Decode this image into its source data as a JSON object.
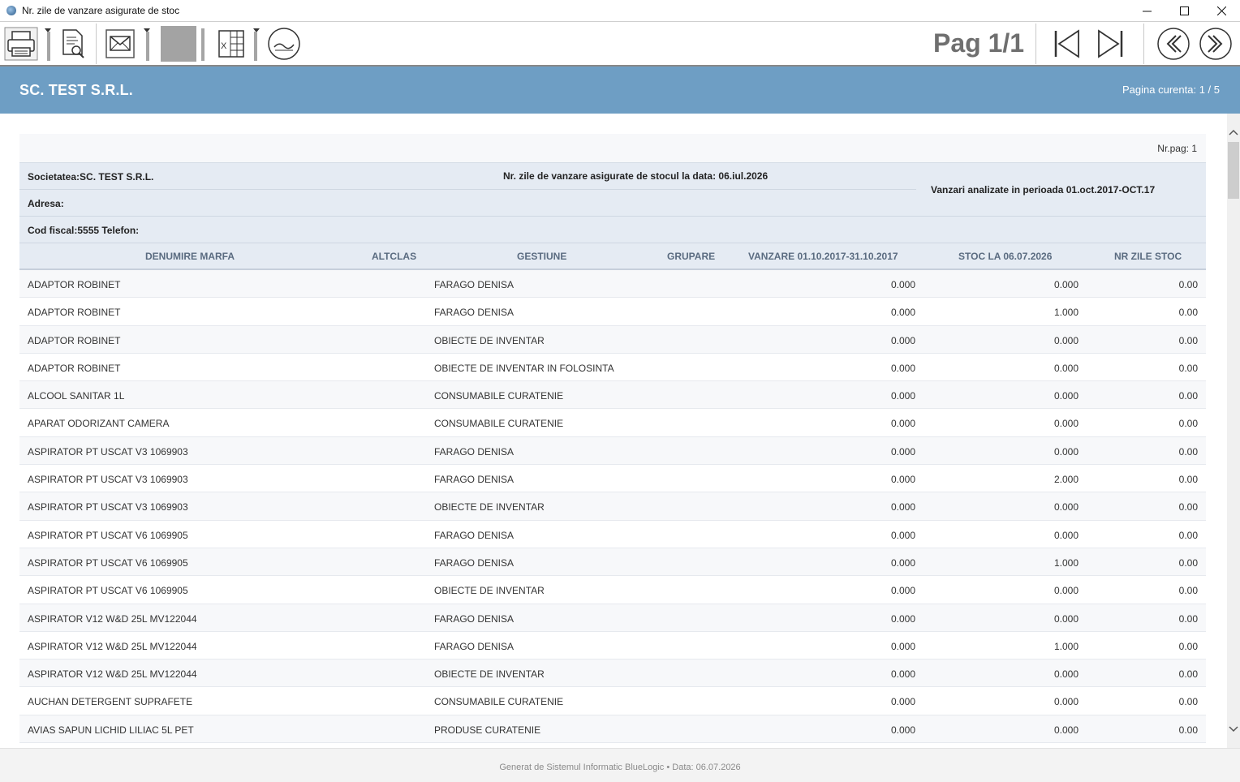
{
  "window": {
    "title": "Nr. zile de vanzare asigurate de stoc"
  },
  "toolbar": {
    "page_label": "Pag 1/1"
  },
  "header": {
    "company": "SC. TEST S.R.L.",
    "current_page": "Pagina curenta: 1 / 5"
  },
  "report": {
    "nr_pag": "Nr.pag: 1",
    "societatea": "Societatea:SC. TEST S.R.L.",
    "adresa": "Adresa:",
    "cod_fiscal": "Cod fiscal:5555 Telefon:",
    "title": "Nr. zile de vanzare asigurate de stocul la data: 06.iul.2026",
    "period": "Vanzari analizate in perioada 01.oct.2017-OCT.17",
    "columns": [
      "DENUMIRE MARFA",
      "ALTCLAS",
      "GESTIUNE",
      "GRUPARE",
      "VANZARE 01.10.2017-31.10.2017",
      "STOC LA 06.07.2026",
      "NR ZILE STOC"
    ],
    "rows": [
      {
        "name": "ADAPTOR ROBINET",
        "gest": "FARAGO DENISA",
        "vanz": "0.000",
        "stoc": "0.000",
        "zile": "0.00"
      },
      {
        "name": "ADAPTOR ROBINET",
        "gest": "FARAGO DENISA",
        "vanz": "0.000",
        "stoc": "1.000",
        "zile": "0.00"
      },
      {
        "name": "ADAPTOR ROBINET",
        "gest": "OBIECTE DE INVENTAR",
        "vanz": "0.000",
        "stoc": "0.000",
        "zile": "0.00"
      },
      {
        "name": "ADAPTOR ROBINET",
        "gest": "OBIECTE DE INVENTAR IN FOLOSINTA",
        "vanz": "0.000",
        "stoc": "0.000",
        "zile": "0.00"
      },
      {
        "name": "ALCOOL SANITAR 1L",
        "gest": "CONSUMABILE CURATENIE",
        "vanz": "0.000",
        "stoc": "0.000",
        "zile": "0.00"
      },
      {
        "name": "APARAT ODORIZANT CAMERA",
        "gest": "CONSUMABILE CURATENIE",
        "vanz": "0.000",
        "stoc": "0.000",
        "zile": "0.00"
      },
      {
        "name": "ASPIRATOR PT USCAT V3 1069903",
        "gest": "FARAGO DENISA",
        "vanz": "0.000",
        "stoc": "0.000",
        "zile": "0.00"
      },
      {
        "name": "ASPIRATOR PT USCAT V3 1069903",
        "gest": "FARAGO DENISA",
        "vanz": "0.000",
        "stoc": "2.000",
        "zile": "0.00"
      },
      {
        "name": "ASPIRATOR PT USCAT V3 1069903",
        "gest": "OBIECTE DE INVENTAR",
        "vanz": "0.000",
        "stoc": "0.000",
        "zile": "0.00"
      },
      {
        "name": "ASPIRATOR PT USCAT V6 1069905",
        "gest": "FARAGO DENISA",
        "vanz": "0.000",
        "stoc": "0.000",
        "zile": "0.00"
      },
      {
        "name": "ASPIRATOR PT USCAT V6 1069905",
        "gest": "FARAGO DENISA",
        "vanz": "0.000",
        "stoc": "1.000",
        "zile": "0.00"
      },
      {
        "name": "ASPIRATOR PT USCAT V6 1069905",
        "gest": "OBIECTE DE INVENTAR",
        "vanz": "0.000",
        "stoc": "0.000",
        "zile": "0.00"
      },
      {
        "name": "ASPIRATOR V12 W&D 25L MV122044",
        "gest": "FARAGO DENISA",
        "vanz": "0.000",
        "stoc": "0.000",
        "zile": "0.00"
      },
      {
        "name": "ASPIRATOR V12 W&D 25L MV122044",
        "gest": "FARAGO DENISA",
        "vanz": "0.000",
        "stoc": "1.000",
        "zile": "0.00"
      },
      {
        "name": "ASPIRATOR V12 W&D 25L MV122044",
        "gest": "OBIECTE DE INVENTAR",
        "vanz": "0.000",
        "stoc": "0.000",
        "zile": "0.00"
      },
      {
        "name": "AUCHAN DETERGENT SUPRAFETE",
        "gest": "CONSUMABILE CURATENIE",
        "vanz": "0.000",
        "stoc": "0.000",
        "zile": "0.00"
      },
      {
        "name": "AVIAS SAPUN LICHID LILIAC 5L PET",
        "gest": "PRODUSE CURATENIE",
        "vanz": "0.000",
        "stoc": "0.000",
        "zile": "0.00"
      }
    ]
  },
  "footer": {
    "text": "Generat de Sistemul Informatic BlueLogic • Data: 06.07.2026"
  }
}
